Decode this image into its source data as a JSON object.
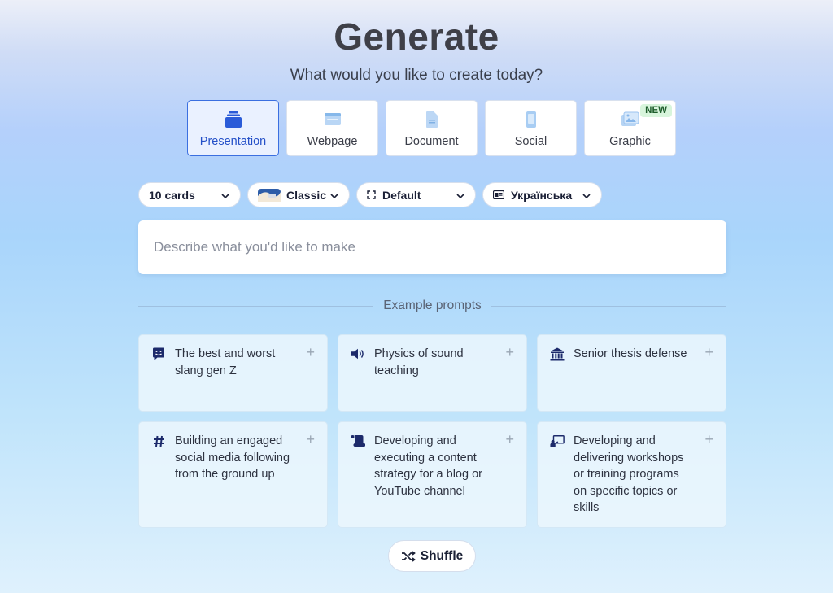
{
  "header": {
    "title": "Generate",
    "subtitle": "What would you like to create today?"
  },
  "content_types": [
    {
      "label": "Presentation",
      "icon": "presentation-icon",
      "active": true
    },
    {
      "label": "Webpage",
      "icon": "webpage-icon"
    },
    {
      "label": "Document",
      "icon": "document-icon"
    },
    {
      "label": "Social",
      "icon": "social-phone-icon"
    },
    {
      "label": "Graphic",
      "icon": "graphic-image-icon",
      "badge": "NEW"
    }
  ],
  "controls": {
    "cards": "10 cards",
    "theme": "Classic",
    "format": "Default",
    "language": "Українська"
  },
  "prompt": {
    "placeholder": "Describe what you'd like to make"
  },
  "examples_heading": "Example prompts",
  "examples": [
    {
      "text": "The best and worst slang gen Z",
      "icon": "chat-smile-icon"
    },
    {
      "text": "Physics of sound teaching",
      "icon": "speaker-icon"
    },
    {
      "text": "Senior thesis defense",
      "icon": "institution-icon"
    },
    {
      "text": "Building an engaged social media following from the ground up",
      "icon": "hashtag-icon"
    },
    {
      "text": "Developing and executing a content strategy for a blog or YouTube channel",
      "icon": "scroll-icon"
    },
    {
      "text": "Developing and delivering workshops or training programs on specific topics or skills",
      "icon": "presenter-board-icon"
    }
  ],
  "shuffle_label": "Shuffle",
  "colors": {
    "accent": "#2450c8",
    "active_bg": "#eaf1ff",
    "badge_bg": "#d8f5dc",
    "icon_dark": "#1c2a6b"
  }
}
